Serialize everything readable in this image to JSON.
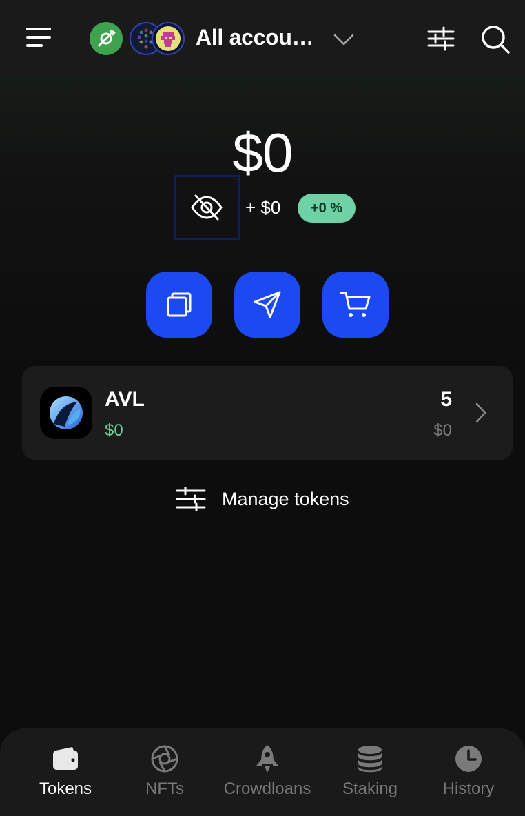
{
  "header": {
    "account_name": "All accou…",
    "menu_icon": "hamburger-menu-icon",
    "filter_icon": "sliders-icon",
    "search_icon": "search-icon"
  },
  "balance": {
    "total": "$0",
    "change": "+ $0",
    "percent": "+0 %",
    "hide_icon": "eye-off-icon"
  },
  "actions": [
    {
      "name": "receive",
      "icon": "copy-icon"
    },
    {
      "name": "send",
      "icon": "send-icon"
    },
    {
      "name": "buy",
      "icon": "cart-icon"
    }
  ],
  "tokens": [
    {
      "symbol": "AVL",
      "value": "$0",
      "amount": "5",
      "fiat": "$0"
    }
  ],
  "manage_tokens_label": "Manage tokens",
  "nav": {
    "tokens": "Tokens",
    "nfts": "NFTs",
    "crowdloans": "Crowdloans",
    "staking": "Staking",
    "history": "History",
    "active": "tokens"
  },
  "colors": {
    "accent": "#1c49f2",
    "positive": "#5fd49a",
    "badge": "#6ed2a6"
  }
}
